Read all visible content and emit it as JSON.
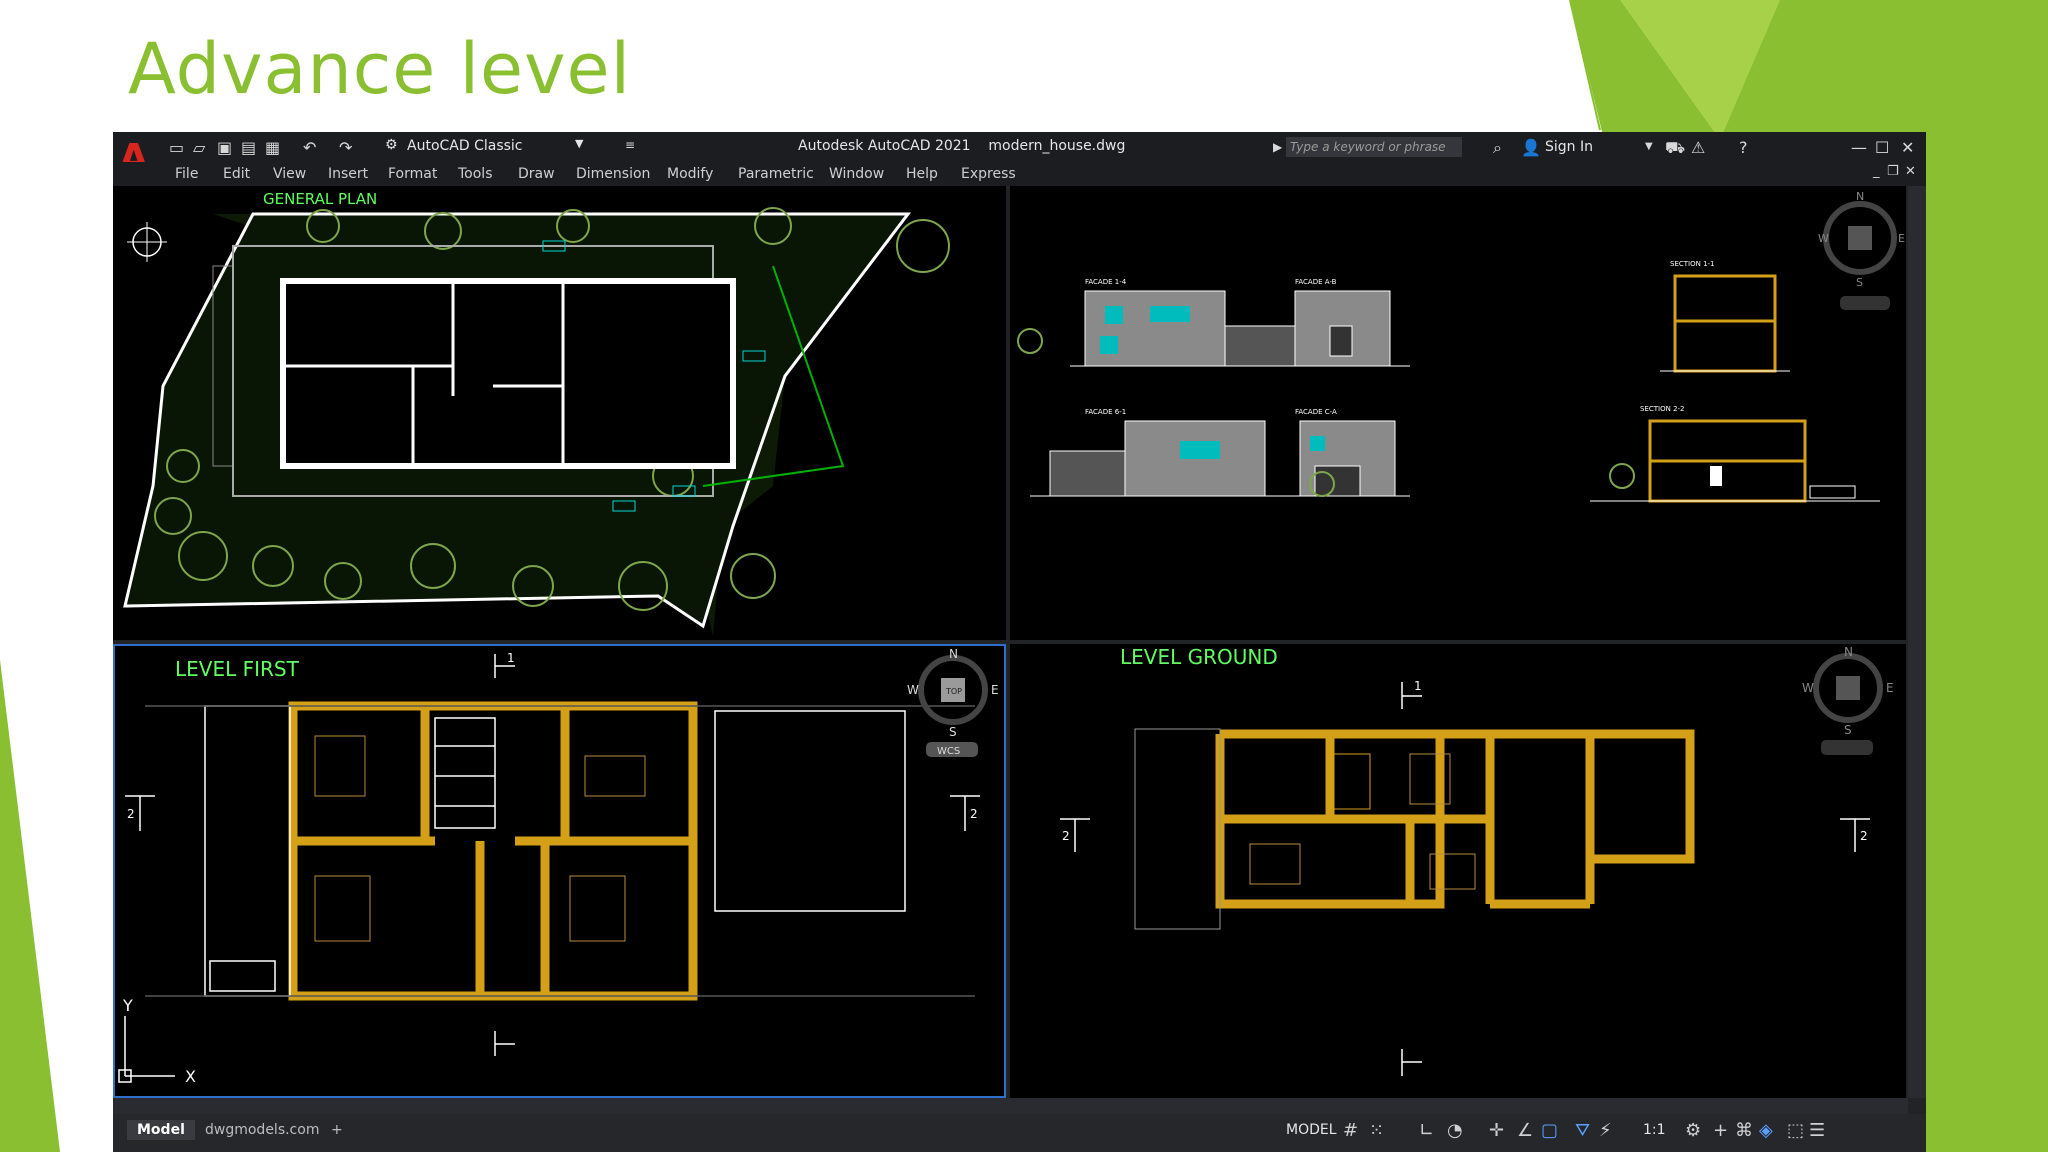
{
  "slide": {
    "title": "Advance level",
    "accent_color": "#8bbf32"
  },
  "app": {
    "logo_letter": "A",
    "workspace": "AutoCAD Classic",
    "title": "Autodesk AutoCAD 2021    modern_house.dwg",
    "search_placeholder": "Type a keyword or phrase",
    "sign_in": "Sign In",
    "menus": [
      "File",
      "Edit",
      "View",
      "Insert",
      "Format",
      "Tools",
      "Draw",
      "Dimension",
      "Modify",
      "Parametric",
      "Window",
      "Help",
      "Express"
    ]
  },
  "viewports": {
    "general_plan": {
      "label": "GENERAL PLAN"
    },
    "facades": {
      "labels": [
        "FACADE 1-4",
        "FACADE A-B",
        "SECTION 1-1",
        "FACADE 6-1",
        "FACADE C-A",
        "SECTION 2-2"
      ]
    },
    "level_first": {
      "label": "LEVEL FIRST"
    },
    "level_ground": {
      "label": "LEVEL GROUND"
    }
  },
  "viewcube": {
    "n": "N",
    "s": "S",
    "e": "E",
    "w": "W",
    "top": "TOP",
    "wcs": "WCS"
  },
  "ucs": {
    "x": "X",
    "y": "Y"
  },
  "section_marks": {
    "one": "1",
    "two": "2"
  },
  "layout_tabs": [
    "Model",
    "dwgmodels.com"
  ],
  "add_tab": "+",
  "status_bar": {
    "mode": "MODEL",
    "scale": "1:1"
  },
  "colors": {
    "wall_fill": "#d4a017",
    "dimension": "#00d5d5",
    "linework": "#ffffff",
    "cad_background": "#000000",
    "vegetation": "#7ea64a"
  }
}
